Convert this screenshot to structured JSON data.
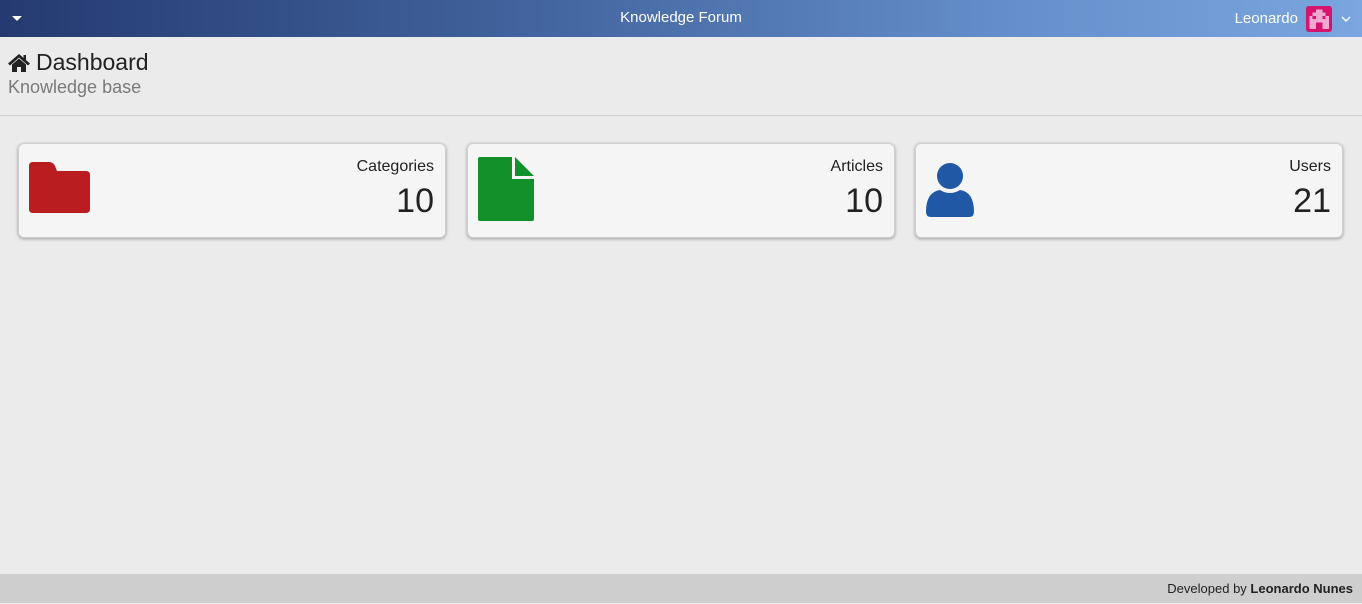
{
  "header": {
    "title": "Knowledge Forum",
    "user_name": "Leonardo",
    "avatar_color": "#d4146f"
  },
  "page": {
    "title": "Dashboard",
    "subtitle": "Knowledge base"
  },
  "stats": [
    {
      "label": "Categories",
      "value": "10",
      "icon": "folder-icon",
      "color": "#b91d20"
    },
    {
      "label": "Articles",
      "value": "10",
      "icon": "file-icon",
      "color": "#14902a"
    },
    {
      "label": "Users",
      "value": "21",
      "icon": "user-icon",
      "color": "#2058a6"
    }
  ],
  "footer": {
    "prefix": "Developed by",
    "author": "Leonardo Nunes"
  }
}
